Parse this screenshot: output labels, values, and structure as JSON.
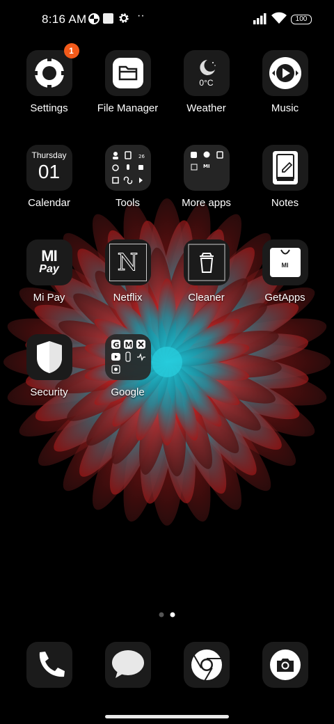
{
  "status_bar": {
    "time": "8:16 AM",
    "battery": "100",
    "icons": [
      "data-saver-icon",
      "notification-square-icon",
      "gear-icon",
      "more-dots-icon",
      "signal-icon",
      "wifi-icon",
      "battery-icon"
    ]
  },
  "apps": [
    {
      "label": "Settings",
      "icon": "settings-icon",
      "badge": "1"
    },
    {
      "label": "File Manager",
      "icon": "folder-icon"
    },
    {
      "label": "Weather",
      "icon": "moon-icon",
      "temp": "0°C"
    },
    {
      "label": "Music",
      "icon": "music-icon"
    },
    {
      "label": "Calendar",
      "icon": "calendar-icon",
      "day_name": "Thursday",
      "day_num": "01"
    },
    {
      "label": "Tools",
      "icon": "folder-icon"
    },
    {
      "label": "More apps",
      "icon": "folder-icon",
      "mini": "MI"
    },
    {
      "label": "Notes",
      "icon": "notes-icon"
    },
    {
      "label": "Mi Pay",
      "icon": "mi-pay-icon",
      "mi": "MI",
      "pay": "Pay"
    },
    {
      "label": "Netflix",
      "icon": "netflix-icon",
      "n": "N"
    },
    {
      "label": "Cleaner",
      "icon": "trash-icon"
    },
    {
      "label": "GetApps",
      "icon": "getapps-icon",
      "mi": "MI"
    },
    {
      "label": "Security",
      "icon": "shield-icon"
    },
    {
      "label": "Google",
      "icon": "folder-icon",
      "g": "G",
      "m": "M"
    }
  ],
  "page_indicator": {
    "pages": 2,
    "current": 2
  },
  "dock": [
    {
      "icon": "phone-icon"
    },
    {
      "icon": "messages-icon"
    },
    {
      "icon": "chrome-icon"
    },
    {
      "icon": "camera-icon"
    }
  ],
  "colors": {
    "background": "#000000",
    "tile": "#1b1b1b",
    "badge": "#f25a1a",
    "wallpaper_red": "#c81e1e",
    "wallpaper_cyan": "#1ec4d6"
  }
}
